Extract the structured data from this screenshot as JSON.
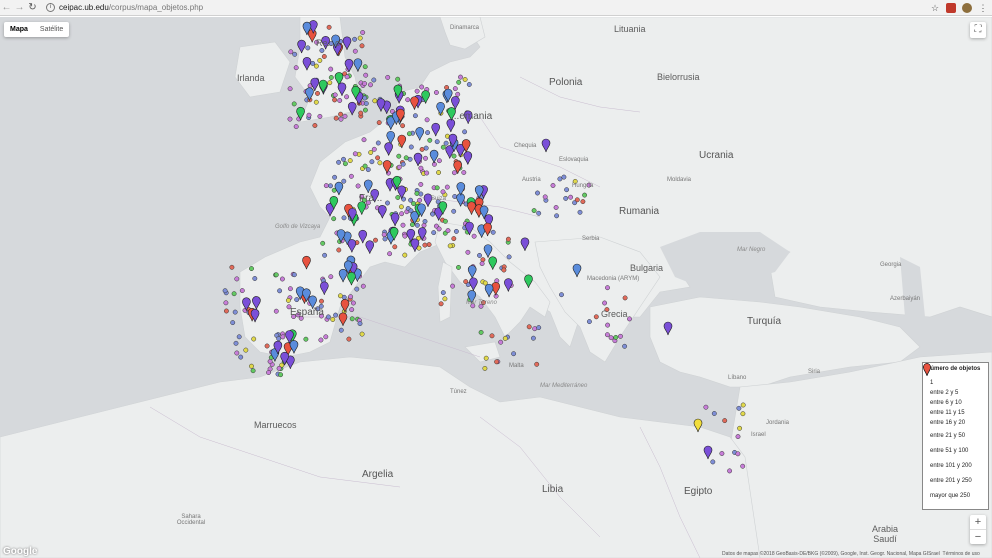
{
  "browser": {
    "back_icon": "arrow-left-icon",
    "forward_icon": "arrow-right-icon",
    "reload_icon": "reload-icon",
    "url_host": "ceipac.ub.edu",
    "url_path": "/corpus/mapa_objetos.php",
    "bookmark_icon": "star-icon",
    "menu_icon": "kebab-menu-icon"
  },
  "map_type": {
    "map_label": "Mapa",
    "satellite_label": "Satélite",
    "active": "Mapa"
  },
  "zoom": {
    "in_label": "+",
    "out_label": "−"
  },
  "places": {
    "lituania": "Lituania",
    "dinamarca": "Dinamarca",
    "irlanda": "Irlanda",
    "reino_unido": "Re...o",
    "polonia": "Polonia",
    "bielorrusia": "Bielorrusia",
    "alemania": "...emania",
    "chequia": "Chequia",
    "ucrania": "Ucrania",
    "eslovaquia": "Eslovaquia",
    "moldavia": "Moldavia",
    "austria": "Austria",
    "hungria": "Hungría",
    "rumania": "Rumania",
    "francia": "Fra...",
    "suiza": "Suiza",
    "golfo_vizcaya": "Golfo de Vizcaya",
    "serbia": "Serbia",
    "bulgaria": "Bulgaria",
    "mar_negro": "Mar Negro",
    "macedonia": "Macedonia (ARYM)",
    "georgia": "Georgia",
    "azerbaiyan": "Azerbaiyán",
    "espana": "España",
    "mar_tirreno": "Mar Tirreno",
    "grecia": "Grecia",
    "turquia": "Turquía",
    "siria": "Siria",
    "libano": "Líbano",
    "israel": "Israel",
    "jordania": "Jordania",
    "malta": "Malta",
    "mar_mediterraneo": "Mar Mediterráneo",
    "tunez": "Túnez",
    "marruecos": "Marruecos",
    "argelia": "Argelia",
    "libia": "Libia",
    "egipto": "Egipto",
    "sahara_occidental": "Sahara Occidental",
    "arabia_saudi": "Arabia Saudí"
  },
  "legend": {
    "title": "Número de objetos",
    "items": [
      {
        "label": "1",
        "color": "#c77dd8",
        "kind": "dot"
      },
      {
        "label": "entre 2 y 5",
        "color": "#7e8ed6",
        "kind": "dot"
      },
      {
        "label": "entre 6 y 10",
        "color": "#63c963",
        "kind": "dot"
      },
      {
        "label": "entre 11 y 15",
        "color": "#e0d84a",
        "kind": "dot"
      },
      {
        "label": "entre 16 y 20",
        "color": "#e06a5a",
        "kind": "dot"
      },
      {
        "label": "entre 21 y 50",
        "color": "#7a4fd8",
        "kind": "pin"
      },
      {
        "label": "entre 51 y 100",
        "color": "#5a8cdc",
        "kind": "pin"
      },
      {
        "label": "entre 101 y 200",
        "color": "#2ec95e",
        "kind": "pin"
      },
      {
        "label": "entre 201 y 250",
        "color": "#f1dd3b",
        "kind": "pin"
      },
      {
        "label": "mayor que 250",
        "color": "#e8523f",
        "kind": "pin"
      }
    ]
  },
  "footer": {
    "attribution": "Datos de mapas ©2018 GeoBasis-DE/BKG (©2009), Google, Inst. Geogr. Nacional, Mapa GISrael",
    "terms": "Términos de uso",
    "logo": "Google"
  },
  "fullscreen_icon": "fullscreen-icon"
}
